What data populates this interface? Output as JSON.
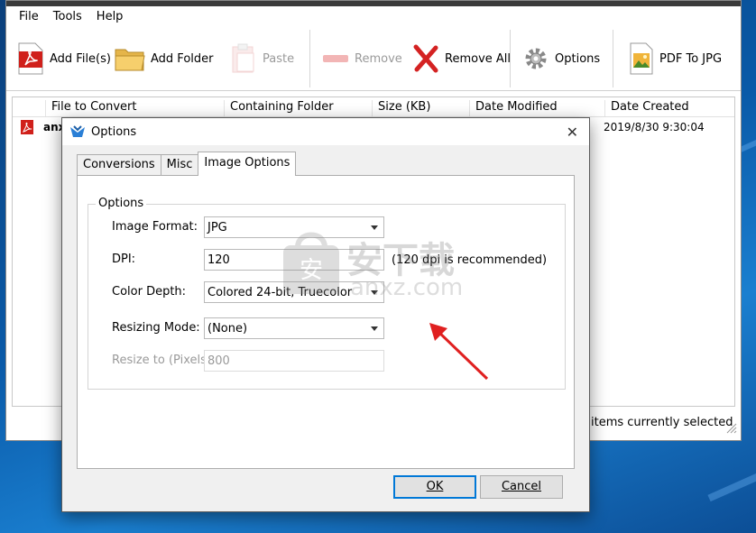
{
  "menu": [
    "File",
    "Tools",
    "Help"
  ],
  "toolbar": {
    "add_files": "Add File(s)",
    "add_folder": "Add Folder",
    "paste": "Paste",
    "remove": "Remove",
    "remove_all": "Remove All",
    "options": "Options",
    "pdf_to_jpg": "PDF To JPG"
  },
  "file_list": {
    "headers": [
      "File to Convert",
      "Containing Folder",
      "Size (KB)",
      "Date Modified",
      "Date Created"
    ],
    "rows": [
      {
        "name": "anx",
        "date_created": "2019/8/30 9:30:04"
      }
    ]
  },
  "statusbar": {
    "text": "items currently selected"
  },
  "dialog": {
    "title": "Options",
    "tabs": [
      "Conversions",
      "Misc",
      "Image Options"
    ],
    "active_tab": "Image Options",
    "group_title": "Options",
    "fields": {
      "image_format": {
        "label": "Image Format:",
        "value": "JPG"
      },
      "dpi": {
        "label": "DPI:",
        "value": "120",
        "hint": "(120 dpi is recommended)"
      },
      "color_depth": {
        "label": "Color Depth:",
        "value": "Colored 24-bit, Truecolor"
      },
      "resizing_mode": {
        "label": "Resizing Mode:",
        "value": "(None)"
      },
      "resize_to": {
        "label": "Resize to (Pixels):",
        "value": "800"
      }
    },
    "ok": "OK",
    "cancel": "Cancel"
  },
  "watermark": {
    "text": "安下载",
    "subtext": "anxz.com"
  },
  "colors": {
    "accent": "#0078d7",
    "pdf_red": "#d0201b",
    "arrow_red": "#e02020"
  }
}
